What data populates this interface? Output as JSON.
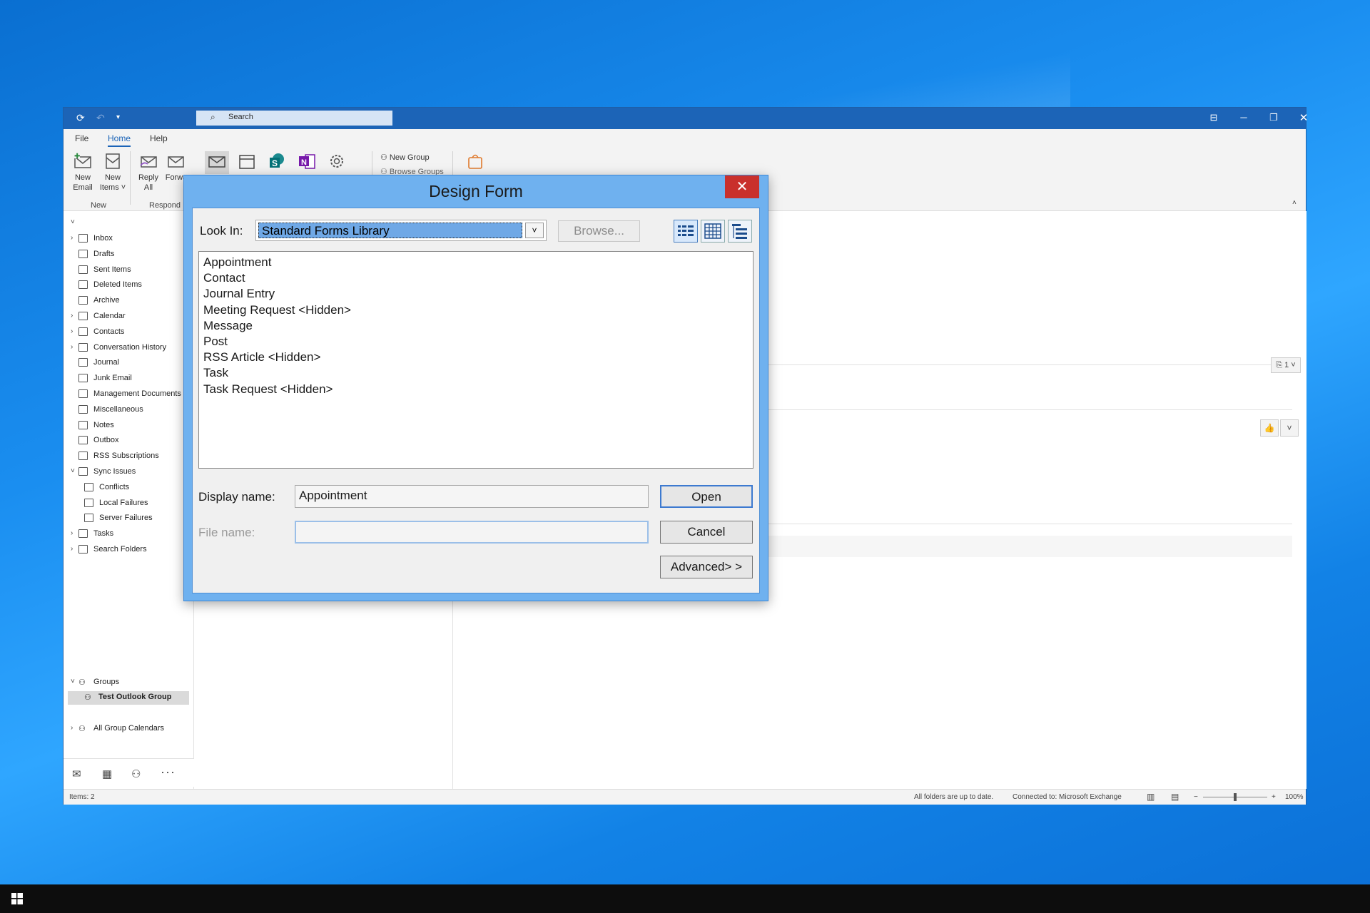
{
  "titlebar": {
    "search_placeholder": "Search"
  },
  "menu": {
    "file": "File",
    "home": "Home",
    "help": "Help"
  },
  "ribbon": {
    "new_email": [
      "New",
      "Email"
    ],
    "new_items": [
      "New",
      "Items ˅"
    ],
    "reply_all": [
      "Reply",
      "All"
    ],
    "forward": "Forwa",
    "group_new": "New",
    "group_respond": "Respond",
    "new_group": "New Group",
    "browse_groups": "Browse Groups"
  },
  "nav": {
    "items": [
      {
        "label": "Inbox",
        "chev": "›",
        "icon": "inbox-icon"
      },
      {
        "label": "Drafts",
        "chev": "",
        "icon": "drafts-icon"
      },
      {
        "label": "Sent Items",
        "chev": "",
        "icon": "folder-icon"
      },
      {
        "label": "Deleted Items",
        "chev": "",
        "icon": "trash-icon"
      },
      {
        "label": "Archive",
        "chev": "",
        "icon": "folder-icon"
      },
      {
        "label": "Calendar",
        "chev": "›",
        "icon": "calendar-icon"
      },
      {
        "label": "Contacts",
        "chev": "›",
        "icon": "contacts-icon"
      },
      {
        "label": "Conversation History",
        "chev": "›",
        "icon": "folder-icon"
      },
      {
        "label": "Journal",
        "chev": "",
        "icon": "journal-icon"
      },
      {
        "label": "Junk Email",
        "chev": "",
        "icon": "junk-icon"
      },
      {
        "label": "Management Documents",
        "chev": "",
        "icon": "sync-folder-icon"
      },
      {
        "label": "Miscellaneous",
        "chev": "",
        "icon": "folder-icon"
      },
      {
        "label": "Notes",
        "chev": "",
        "icon": "folder-icon"
      },
      {
        "label": "Outbox",
        "chev": "",
        "icon": "outbox-icon"
      },
      {
        "label": "RSS Subscriptions",
        "chev": "",
        "icon": "rss-icon"
      },
      {
        "label": "Sync Issues",
        "chev": "˅",
        "icon": "folder-icon"
      },
      {
        "label": "Conflicts",
        "chev": "",
        "icon": "warning-folder-icon"
      },
      {
        "label": "Local Failures",
        "chev": "",
        "icon": "warning-folder-icon"
      },
      {
        "label": "Server Failures",
        "chev": "",
        "icon": "warning-folder-icon"
      },
      {
        "label": "Tasks",
        "chev": "›",
        "icon": "tasks-icon"
      },
      {
        "label": "Search Folders",
        "chev": "›",
        "icon": "search-folder-icon"
      }
    ],
    "groups_header": "Groups",
    "test_group": "Test Outlook Group",
    "all_group_calendars": "All Group Calendars"
  },
  "status": {
    "items": "Items: 2",
    "sync": "All folders are up to date.",
    "connection": "Connected to: Microsoft Exchange",
    "zoom": "100%"
  },
  "reading_pane": {
    "attachment_count": "1"
  },
  "dialog": {
    "title": "Design Form",
    "close_label": "✕",
    "look_in_label": "Look In:",
    "look_in_value": "Standard Forms Library",
    "browse_label": "Browse...",
    "forms": [
      "Appointment",
      "Contact",
      "Journal Entry",
      "Meeting Request <Hidden>",
      "Message",
      "Post",
      "RSS Article <Hidden>",
      "Task",
      "Task Request <Hidden>"
    ],
    "display_name_label": "Display name:",
    "display_name_value": "Appointment",
    "file_name_label": "File name:",
    "file_name_value": "",
    "open_label": "Open",
    "cancel_label": "Cancel",
    "advanced_label": "Advanced> >"
  },
  "colors": {
    "accent": "#1c64b7",
    "dialog_frame": "#6fb1ef",
    "close_red": "#c9302c"
  }
}
